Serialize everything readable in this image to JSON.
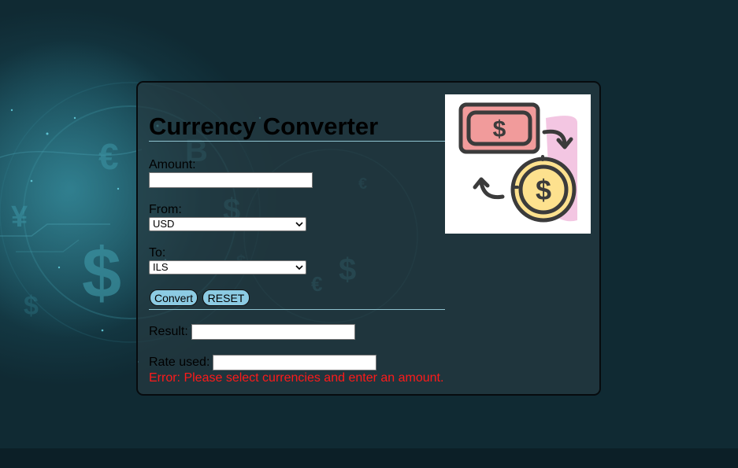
{
  "app": {
    "title": "Currency Converter"
  },
  "form": {
    "amount_label": "Amount:",
    "amount_value": "",
    "from_label": "From:",
    "from_selected": "USD",
    "to_label": "To:",
    "to_selected": "ILS",
    "convert_label": "Convert",
    "reset_label": "RESET",
    "result_label": "Result:",
    "result_value": "",
    "rate_label": "Rate used:",
    "rate_value": ""
  },
  "status": {
    "error_message": "Error: Please select currencies and enter an amount.",
    "error_color": "#ff1a1a"
  },
  "background": {
    "currency_symbols": [
      "€",
      "B",
      "$",
      "¥",
      "$",
      "€",
      "$",
      "$",
      "€",
      "$"
    ]
  },
  "icons": {
    "logo": "currency-exchange-icon",
    "select_arrow": "chevron-down-icon"
  },
  "colors": {
    "panel_border": "#070b0e",
    "button_fill": "#8ccbe3",
    "rule": "#8fc3d0",
    "bill_red": "#f19b9b",
    "coin_yellow": "#fde18e",
    "accent_pink": "#f3c6e2"
  }
}
